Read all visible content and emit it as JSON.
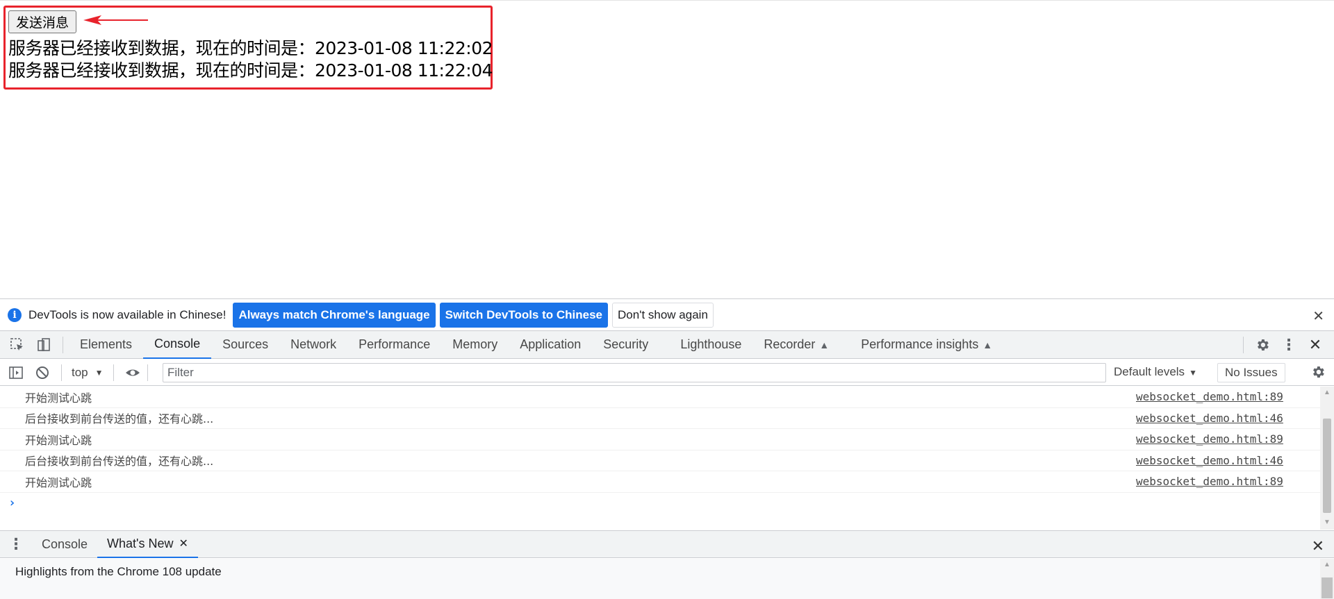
{
  "page": {
    "send_button": "发送消息",
    "messages": [
      "服务器已经接收到数据，现在的时间是：2023-01-08 11:22:02",
      "服务器已经接收到数据，现在的时间是：2023-01-08 11:22:04"
    ]
  },
  "infobar": {
    "text": "DevTools is now available in Chinese!",
    "btn_match": "Always match Chrome's language",
    "btn_switch": "Switch DevTools to Chinese",
    "btn_dismiss": "Don't show again"
  },
  "tabs": [
    "Elements",
    "Console",
    "Sources",
    "Network",
    "Performance",
    "Memory",
    "Application",
    "Security",
    "Lighthouse",
    "Recorder",
    "Performance insights"
  ],
  "console_toolbar": {
    "context": "top",
    "filter_placeholder": "Filter",
    "levels": "Default levels",
    "issues": "No Issues"
  },
  "logs": [
    {
      "msg": "开始测试心跳",
      "src": "websocket_demo.html:89"
    },
    {
      "msg": "后台接收到前台传送的值，还有心跳...",
      "src": "websocket_demo.html:46"
    },
    {
      "msg": "开始测试心跳",
      "src": "websocket_demo.html:89"
    },
    {
      "msg": "后台接收到前台传送的值，还有心跳...",
      "src": "websocket_demo.html:46"
    },
    {
      "msg": "开始测试心跳",
      "src": "websocket_demo.html:89"
    }
  ],
  "drawer": {
    "tab_console": "Console",
    "tab_whats_new": "What's New",
    "highlights": "Highlights from the Chrome 108 update"
  },
  "colors": {
    "accent": "#1a73e8",
    "highlight_border": "#e8232c"
  }
}
